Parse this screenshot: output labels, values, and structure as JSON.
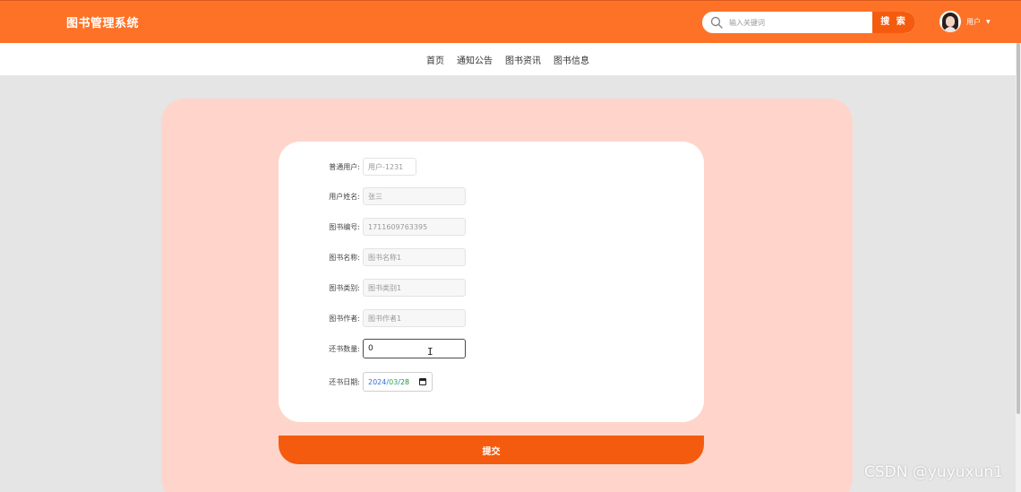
{
  "header": {
    "brand": "图书管理系统",
    "search": {
      "placeholder": "输入关键词",
      "button_label": "搜 索"
    },
    "user_label": "用户"
  },
  "nav": {
    "items": [
      {
        "label": "首页"
      },
      {
        "label": "通知公告"
      },
      {
        "label": "图书资讯"
      },
      {
        "label": "图书信息"
      }
    ]
  },
  "form": {
    "fields": [
      {
        "label": "普通用户:",
        "value": "用户-1231"
      },
      {
        "label": "用户姓名:",
        "value": "张三"
      },
      {
        "label": "图书编号:",
        "value": "1711609763395"
      },
      {
        "label": "图书名称:",
        "value": "图书名称1"
      },
      {
        "label": "图书类别:",
        "value": "图书类别1"
      },
      {
        "label": "图书作者:",
        "value": "图书作者1"
      },
      {
        "label": "还书数量:",
        "value": "0"
      },
      {
        "label": "还书日期:",
        "value": {
          "year": "2024",
          "month": "03",
          "day": "28",
          "sep": "/"
        }
      }
    ],
    "submit_label": "提交"
  },
  "watermark": "CSDN @yuyuxun1",
  "colors": {
    "header": "#fe7227",
    "accent": "#f55b0e",
    "panel": "#ffd5cb",
    "page_bg": "#e5e5e5"
  }
}
